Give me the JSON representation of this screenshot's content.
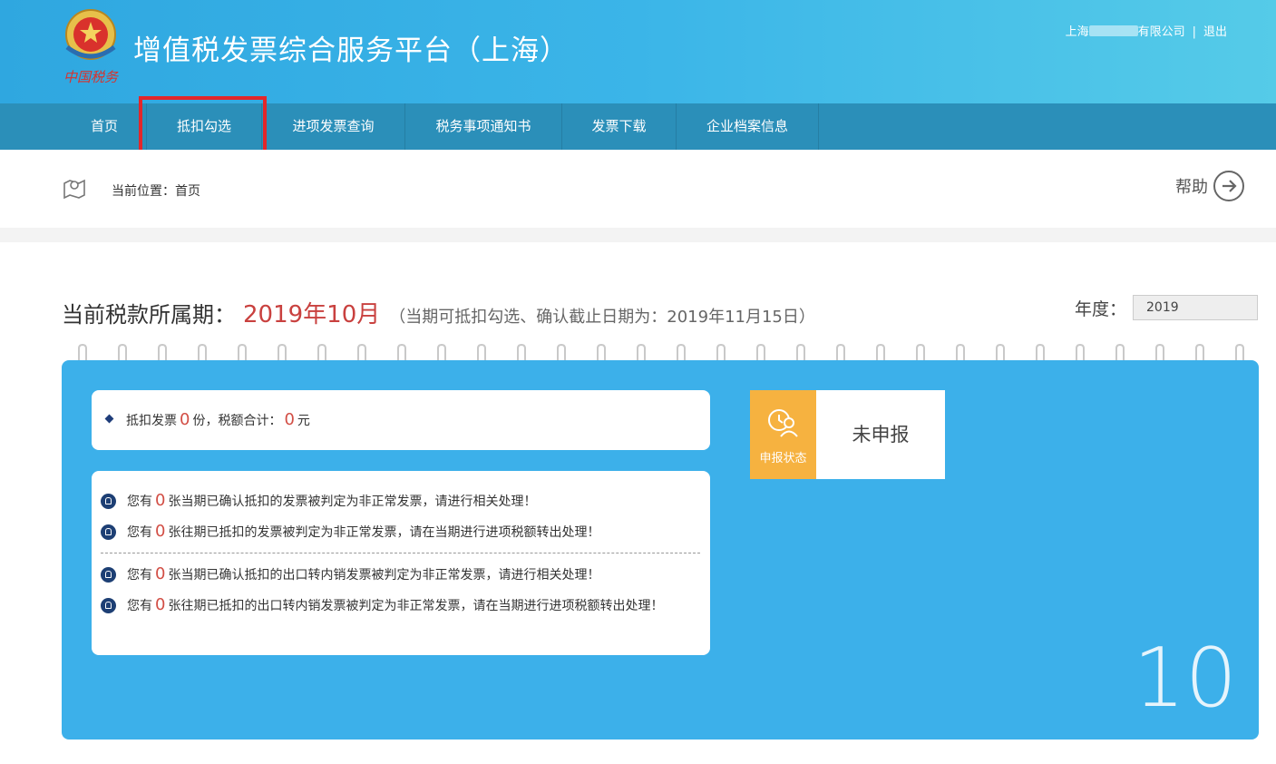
{
  "header": {
    "title": "增值税发票综合服务平台（上海）",
    "emblem_text": "中国税务",
    "user_prefix": "上海",
    "user_suffix": "有限公司",
    "separator": "|",
    "logout": "退出"
  },
  "nav": {
    "items": [
      {
        "label": "首页"
      },
      {
        "label": "抵扣勾选"
      },
      {
        "label": "进项发票查询"
      },
      {
        "label": "税务事项通知书"
      },
      {
        "label": "发票下载"
      },
      {
        "label": "企业档案信息"
      }
    ]
  },
  "breadcrumb": {
    "label": "当前位置：首页",
    "help": "帮助"
  },
  "period": {
    "label": "当前税款所属期：",
    "value": "2019年10月",
    "note": "（当期可抵扣勾选、确认截止日期为：2019年11月15日）",
    "year_label": "年度：",
    "year_value": "2019"
  },
  "summary": {
    "prefix": "抵扣发票",
    "count": "0",
    "mid": "份，税额合计：",
    "amount": "0",
    "suffix": "元"
  },
  "messages": [
    {
      "pre": "您有",
      "count": "0",
      "text": "张当期已确认抵扣的发票被判定为非正常发票，请进行相关处理！"
    },
    {
      "pre": "您有",
      "count": "0",
      "text": "张往期已抵扣的发票被判定为非正常发票，请在当期进行进项税额转出处理！"
    },
    {
      "pre": "您有",
      "count": "0",
      "text": "张当期已确认抵扣的出口转内销发票被判定为非正常发票，请进行相关处理！"
    },
    {
      "pre": "您有",
      "count": "0",
      "text": "张往期已抵扣的出口转内销发票被判定为非正常发票，请在当期进行进项税额转出处理！"
    }
  ],
  "status": {
    "label": "申报状态",
    "value": "未申报"
  },
  "calendar": {
    "month_number": "10"
  },
  "colors": {
    "header_blue": "#3bb5e8",
    "nav_blue": "#2b8fb9",
    "calendar_blue": "#3cb0ea",
    "highlight_red": "#e3262a",
    "period_red": "#c9413f",
    "status_orange": "#f6b240"
  }
}
